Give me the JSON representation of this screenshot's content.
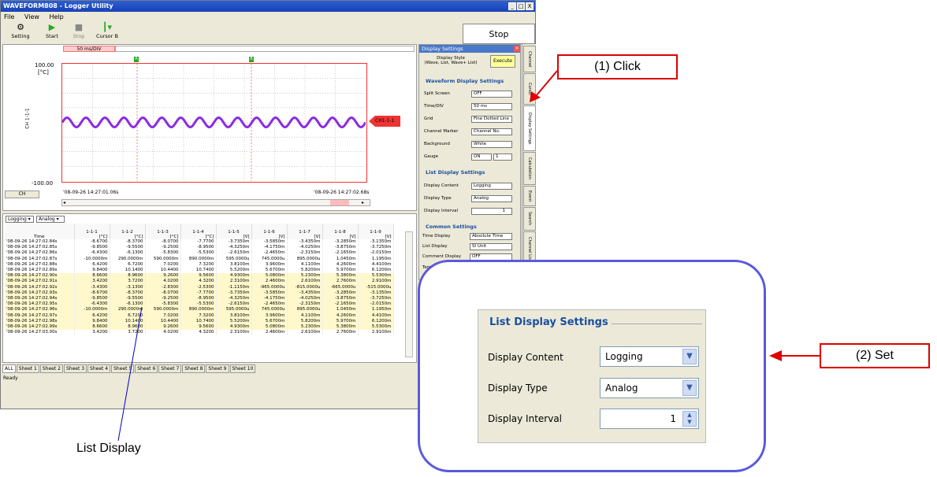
{
  "window": {
    "title": "WAVEFORM808 - Logger Utility",
    "controls": [
      "_",
      "□",
      "X"
    ]
  },
  "menu": [
    "File",
    "View",
    "Help"
  ],
  "toolbar": {
    "buttons": [
      "Setting",
      "Start",
      "Stop",
      "Cursor B"
    ],
    "stop_status": "Stop"
  },
  "waveform": {
    "time_div": "50 ms/DIV",
    "y_max": "100.00",
    "y_unit": "[°C]",
    "y_min": "-100.00",
    "channel_axis": "CH 1-1-1",
    "cursor_a": "A",
    "cursor_b": "B",
    "ch_button": "CH",
    "start_time": "'08-09-26 14:27:01.06s",
    "end_time": "'08-09-26 14:27:02.68s",
    "marker": "CH1-1-1",
    "trace_color": "#8b2be2"
  },
  "list": {
    "content_select": "Logging",
    "type_select": "Analog",
    "time_header": "Time",
    "columns": [
      {
        "name": "1-1-1",
        "unit": "[°C]"
      },
      {
        "name": "1-1-2",
        "unit": "[°C]"
      },
      {
        "name": "1-1-3",
        "unit": "[°C]"
      },
      {
        "name": "1-1-4",
        "unit": "[°C]"
      },
      {
        "name": "1-1-5",
        "unit": "[V]"
      },
      {
        "name": "1-1-6",
        "unit": "[V]"
      },
      {
        "name": "1-1-7",
        "unit": "[V]"
      },
      {
        "name": "1-1-8",
        "unit": "[V]"
      },
      {
        "name": "1-1-9",
        "unit": "[V]"
      }
    ],
    "rows": [
      [
        "'08-09-26 14:27:02.84s",
        "-8.6700",
        "-8.3700",
        "-8.0700",
        "-7.7700",
        "-3.7350m",
        "-3.5850m",
        "-3.4350m",
        "-3.2850m",
        "-3.1350m"
      ],
      [
        "'08-09-26 14:27:02.85s",
        "-9.8500",
        "-9.5500",
        "-9.2500",
        "-8.9500",
        "-4.3250m",
        "-4.1750m",
        "-4.0250m",
        "-3.8750m",
        "-3.7250m"
      ],
      [
        "'08-09-26 14:27:02.86s",
        "-6.4300",
        "-6.1300",
        "-5.8300",
        "-5.5300",
        "-2.6150m",
        "-2.4650m",
        "-2.3150m",
        "-2.1650m",
        "-2.0150m"
      ],
      [
        "'08-09-26 14:27:02.87s",
        "-10.0000m",
        "290.0000m",
        "590.0000m",
        "890.0000m",
        "595.0000u",
        "745.0000u",
        "895.0000u",
        "1.0450m",
        "1.1950m"
      ],
      [
        "'08-09-26 14:27:02.88s",
        "6.4200",
        "6.7200",
        "7.0200",
        "7.3200",
        "3.8100m",
        "3.9600m",
        "4.1100m",
        "4.2600m",
        "4.4100m"
      ],
      [
        "'08-09-26 14:27:02.89s",
        "9.8400",
        "10.1400",
        "10.4400",
        "10.7400",
        "5.5200m",
        "5.6700m",
        "5.8200m",
        "5.9700m",
        "6.1200m"
      ],
      [
        "'08-09-26 14:27:02.90s",
        "8.6600",
        "8.9600",
        "9.2600",
        "9.5600",
        "4.9300m",
        "5.0800m",
        "5.2300m",
        "5.3800m",
        "5.5300m"
      ],
      [
        "'08-09-26 14:27:02.91s",
        "3.4200",
        "3.7200",
        "4.0200",
        "4.3200",
        "2.3100m",
        "2.4600m",
        "2.6100m",
        "2.7600m",
        "2.9100m"
      ],
      [
        "'08-09-26 14:27:02.92s",
        "-3.4300",
        "-3.1300",
        "-2.8300",
        "-2.5300",
        "-1.1150m",
        "-965.0000u",
        "-815.0000u",
        "-665.0000u",
        "-515.0000u"
      ],
      [
        "'08-09-26 14:27:02.93s",
        "-8.6700",
        "-8.3700",
        "-8.0700",
        "-7.7700",
        "-3.7350m",
        "-3.5850m",
        "-3.4350m",
        "-3.2850m",
        "-3.1350m"
      ],
      [
        "'08-09-26 14:27:02.94s",
        "-9.8500",
        "-9.5500",
        "-9.2500",
        "-8.9500",
        "-4.3250m",
        "-4.1750m",
        "-4.0250m",
        "-3.8750m",
        "-3.7250m"
      ],
      [
        "'08-09-26 14:27:02.95s",
        "-6.4300",
        "-6.1300",
        "-5.8300",
        "-5.5300",
        "-2.6150m",
        "-2.4650m",
        "-2.3150m",
        "-2.1650m",
        "-2.0150m"
      ],
      [
        "'08-09-26 14:27:02.96s",
        "-10.0000m",
        "290.0000m",
        "590.0000m",
        "890.0000m",
        "595.0000u",
        "745.0000u",
        "895.0000u",
        "1.0450m",
        "1.1950m"
      ],
      [
        "'08-09-26 14:27:02.97s",
        "6.4200",
        "6.7200",
        "7.0200",
        "7.3200",
        "3.8100m",
        "3.9600m",
        "4.1100m",
        "4.2600m",
        "4.4100m"
      ],
      [
        "'08-09-26 14:27:02.98s",
        "9.8400",
        "10.1400",
        "10.4400",
        "10.7400",
        "5.5200m",
        "5.6700m",
        "5.8200m",
        "5.9700m",
        "6.1200m"
      ],
      [
        "'08-09-26 14:27:02.99s",
        "8.6600",
        "8.9600",
        "9.2600",
        "9.5600",
        "4.9300m",
        "5.0800m",
        "5.2300m",
        "5.3800m",
        "5.5300m"
      ],
      [
        "'08-09-26 14:27:03.00s",
        "3.4200",
        "3.7200",
        "4.0200",
        "4.3200",
        "2.3100m",
        "2.4600m",
        "2.6100m",
        "2.7600m",
        "2.9100m"
      ]
    ],
    "highlight_rows": [
      6,
      7,
      8,
      9,
      10,
      11,
      12,
      13,
      14,
      15
    ]
  },
  "sheets": [
    "ALL",
    "Sheet 1",
    "Sheet 2",
    "Sheet 3",
    "Sheet 4",
    "Sheet 5",
    "Sheet 6",
    "Sheet 7",
    "Sheet 8",
    "Sheet 9",
    "Sheet 10"
  ],
  "status": "Ready",
  "settings": {
    "title": "Display Settings",
    "display_style": "Display Style\n(Wave, List, Wave+ List)",
    "execute": "Execute",
    "waveform_header": "Waveform Display Settings",
    "split_screen_label": "Split Screen",
    "split_screen": "OFF",
    "time_div_label": "Time/DIV",
    "time_div": "50 ms",
    "grid_label": "Grid",
    "grid": "Fine Dotted Line",
    "channel_marker_label": "Channel Marker",
    "channel_marker": "Channel No.",
    "background_label": "Background",
    "background": "White",
    "gauge_label": "Gauge",
    "gauge": "ON",
    "gauge_num": "1",
    "list_header": "List Display Settings",
    "display_content_label": "Display Content",
    "display_content": "Logging",
    "display_type_label": "Display Type",
    "display_type": "Analog",
    "display_interval_label": "Display Interval",
    "display_interval": "1",
    "common_header": "Common Settings",
    "time_display_label": "Time Display",
    "time_display": "Absolute Time",
    "list_display_label": "List Display",
    "list_display": "SI Unit",
    "comment_display_label": "Comment Display",
    "comment_display": "OFF",
    "temperature_unit_label": "Temperature Unit"
  },
  "vtabs": [
    "Channel",
    "Cursor",
    "Display Settings",
    "Calculation",
    "Event",
    "Search",
    "Channel List"
  ],
  "annotations": {
    "click": "(1) Click",
    "set": "(2) Set",
    "list_display": "List Display"
  },
  "colors": {
    "annotation_red": "#d00000",
    "zoom_border": "#5a5adc",
    "section_blue": "#1a4fa0"
  }
}
